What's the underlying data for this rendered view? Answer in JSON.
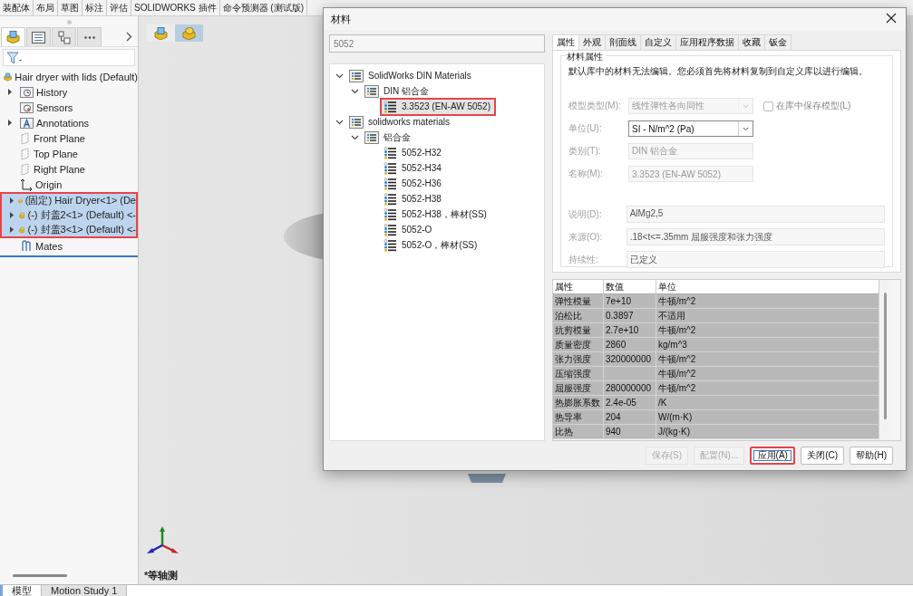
{
  "toolbar_tabs": [
    {
      "label": "装配体"
    },
    {
      "label": "布局"
    },
    {
      "label": "草图"
    },
    {
      "label": "标注"
    },
    {
      "label": "评估"
    },
    {
      "label": "SOLIDWORKS 插件"
    },
    {
      "label": "命令预测器 (测试版)"
    }
  ],
  "feature_panel": {
    "tabs": [
      {
        "kind": "feature_tree",
        "selected": true
      },
      {
        "kind": "property_manager",
        "selected": false
      },
      {
        "kind": "configuration_manager",
        "selected": false
      },
      {
        "kind": "more",
        "selected": false
      }
    ],
    "tree": {
      "label": "Hair dryer with lids (Default)",
      "kind": "assembly",
      "children": [
        {
          "label": "History",
          "kind": "history",
          "expanded": false
        },
        {
          "label": "Sensors",
          "kind": "sensors"
        },
        {
          "label": "Annotations",
          "kind": "annotations",
          "expanded": false
        },
        {
          "label": "Front Plane",
          "kind": "plane"
        },
        {
          "label": "Top Plane",
          "kind": "plane"
        },
        {
          "label": "Right Plane",
          "kind": "plane"
        },
        {
          "label": "Origin",
          "kind": "origin"
        },
        {
          "label": "(固定) Hair Dryer<1> (De",
          "kind": "part",
          "expanded": false,
          "selected": true,
          "highlighted": true
        },
        {
          "label": "(-) 封盖2<1> (Default) <-",
          "kind": "part",
          "expanded": false,
          "selected": true,
          "highlighted": true
        },
        {
          "label": "(-) 封盖3<1> (Default) <-",
          "kind": "part",
          "expanded": false,
          "selected": true,
          "highlighted": true
        },
        {
          "label": "Mates",
          "kind": "mates"
        }
      ]
    }
  },
  "viewport": {
    "view_label": "*等轴测"
  },
  "bottom_tabs": [
    {
      "label": "模型",
      "selected": true
    },
    {
      "label": "Motion Study 1",
      "selected": false
    }
  ],
  "dialog": {
    "title": "材料",
    "search": {
      "value": "5052"
    },
    "library_tree": [
      {
        "label": "SolidWorks DIN Materials",
        "kind": "library",
        "expanded": true,
        "children": [
          {
            "label": "DIN 铝合金",
            "kind": "library",
            "expanded": true,
            "children": [
              {
                "label": "3.3523 (EN-AW 5052)",
                "kind": "material",
                "selected": true,
                "highlighted": true
              }
            ]
          }
        ]
      },
      {
        "label": "solidworks materials",
        "kind": "library",
        "expanded": true,
        "children": [
          {
            "label": "铝合金",
            "kind": "library",
            "expanded": true,
            "children": [
              {
                "label": "5052-H32",
                "kind": "material",
                "selected": false
              },
              {
                "label": "5052-H34",
                "kind": "material",
                "selected": false
              },
              {
                "label": "5052-H36",
                "kind": "material",
                "selected": false
              },
              {
                "label": "5052-H38",
                "kind": "material",
                "selected": false
              },
              {
                "label": "5052-H38，棒材(SS)",
                "kind": "material",
                "selected": false
              },
              {
                "label": "5052-O",
                "kind": "material",
                "selected": false
              },
              {
                "label": "5052-O，棒材(SS)",
                "kind": "material",
                "selected": false
              }
            ]
          }
        ]
      }
    ],
    "tabs": [
      {
        "label": "属性",
        "selected": true
      },
      {
        "label": "外观",
        "selected": false
      },
      {
        "label": "剖面线",
        "selected": false
      },
      {
        "label": "自定义",
        "selected": false
      },
      {
        "label": "应用程序数据",
        "selected": false
      },
      {
        "label": "收藏",
        "selected": false
      },
      {
        "label": "钣金",
        "selected": false
      }
    ],
    "group_title": "材料属性",
    "note": "默认库中的材料无法编辑。您必须首先将材料复制到自定义库以进行编辑。",
    "fields": [
      {
        "label": "模型类型(M):",
        "value": "线性弹性各向同性",
        "kind": "dropdown",
        "disabled": true
      },
      {
        "label": "单位(U):",
        "value": "SI - N/m^2 (Pa)",
        "kind": "dropdown",
        "disabled": false
      },
      {
        "label": "类别(T):",
        "value": "DIN 铝合金",
        "kind": "text",
        "disabled": true
      },
      {
        "label": "名称(M):",
        "value": "3.3523 (EN-AW 5052)",
        "kind": "text",
        "disabled": true
      }
    ],
    "save_model_checkbox": {
      "label": "在库中保存模型(L)",
      "checked": false,
      "disabled": true
    },
    "description_fields": [
      {
        "label": "说明(D):",
        "value": "AlMg2,5"
      },
      {
        "label": "来源(O):",
        "value": ".18<t<=.35mm 屈服强度和张力强度"
      },
      {
        "label": "持续性:",
        "value": "已定义"
      }
    ],
    "table": {
      "columns": [
        "属性",
        "数值",
        "单位"
      ],
      "rows": [
        [
          "弹性模量",
          "7e+10",
          "牛顿/m^2"
        ],
        [
          "泊松比",
          "0.3897",
          "不适用"
        ],
        [
          "抗剪模量",
          "2.7e+10",
          "牛顿/m^2"
        ],
        [
          "质量密度",
          "2860",
          "kg/m^3"
        ],
        [
          "张力强度",
          "320000000",
          "牛顿/m^2"
        ],
        [
          "压缩强度",
          "",
          "牛顿/m^2"
        ],
        [
          "屈服强度",
          "280000000",
          "牛顿/m^2"
        ],
        [
          "热膨胀系数",
          "2.4e-05",
          "/K"
        ],
        [
          "热导率",
          "204",
          "W/(m·K)"
        ],
        [
          "比热",
          "940",
          "J/(kg·K)"
        ]
      ]
    },
    "buttons": [
      {
        "label": "保存(S)",
        "disabled": true,
        "highlighted": false
      },
      {
        "label": "配置(N)...",
        "disabled": true,
        "highlighted": false
      },
      {
        "label": "应用(A)",
        "disabled": false,
        "highlighted": true
      },
      {
        "label": "关闭(C)",
        "disabled": false,
        "highlighted": false
      },
      {
        "label": "帮助(H)",
        "disabled": false,
        "highlighted": false
      }
    ]
  }
}
